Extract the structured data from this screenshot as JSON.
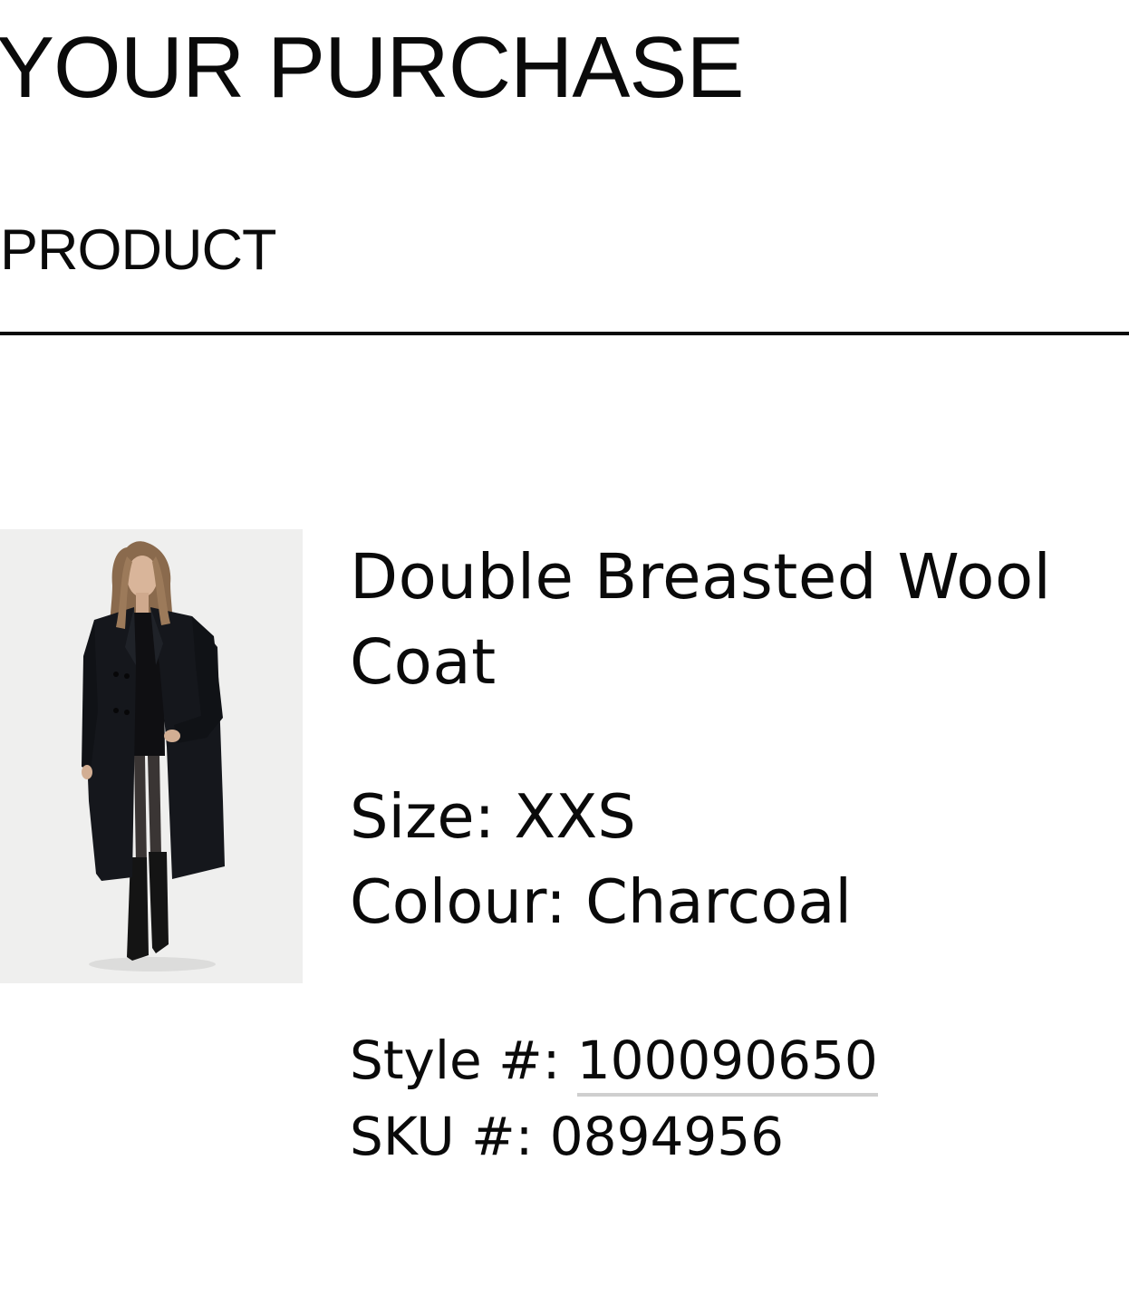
{
  "header": {
    "title": "YOUR PURCHASE",
    "section_label": "PRODUCT"
  },
  "product": {
    "name": "Double Breasted Wool Coat",
    "size_label": "Size:",
    "size_value": "XXS",
    "colour_label": "Colour:",
    "colour_value": "Charcoal",
    "style_label": "Style #:",
    "style_value": "100090650",
    "sku_label": "SKU #:",
    "sku_value": "0894956",
    "image_alt": "Model wearing the Double Breasted Wool Coat in Charcoal",
    "image_icon": "product-photo"
  },
  "colors": {
    "text": "#0a0a0a",
    "divider": "#0a0a0a",
    "link_underline": "#cfcfcf",
    "image_background": "#eeeeed",
    "coat": "#15171c"
  }
}
